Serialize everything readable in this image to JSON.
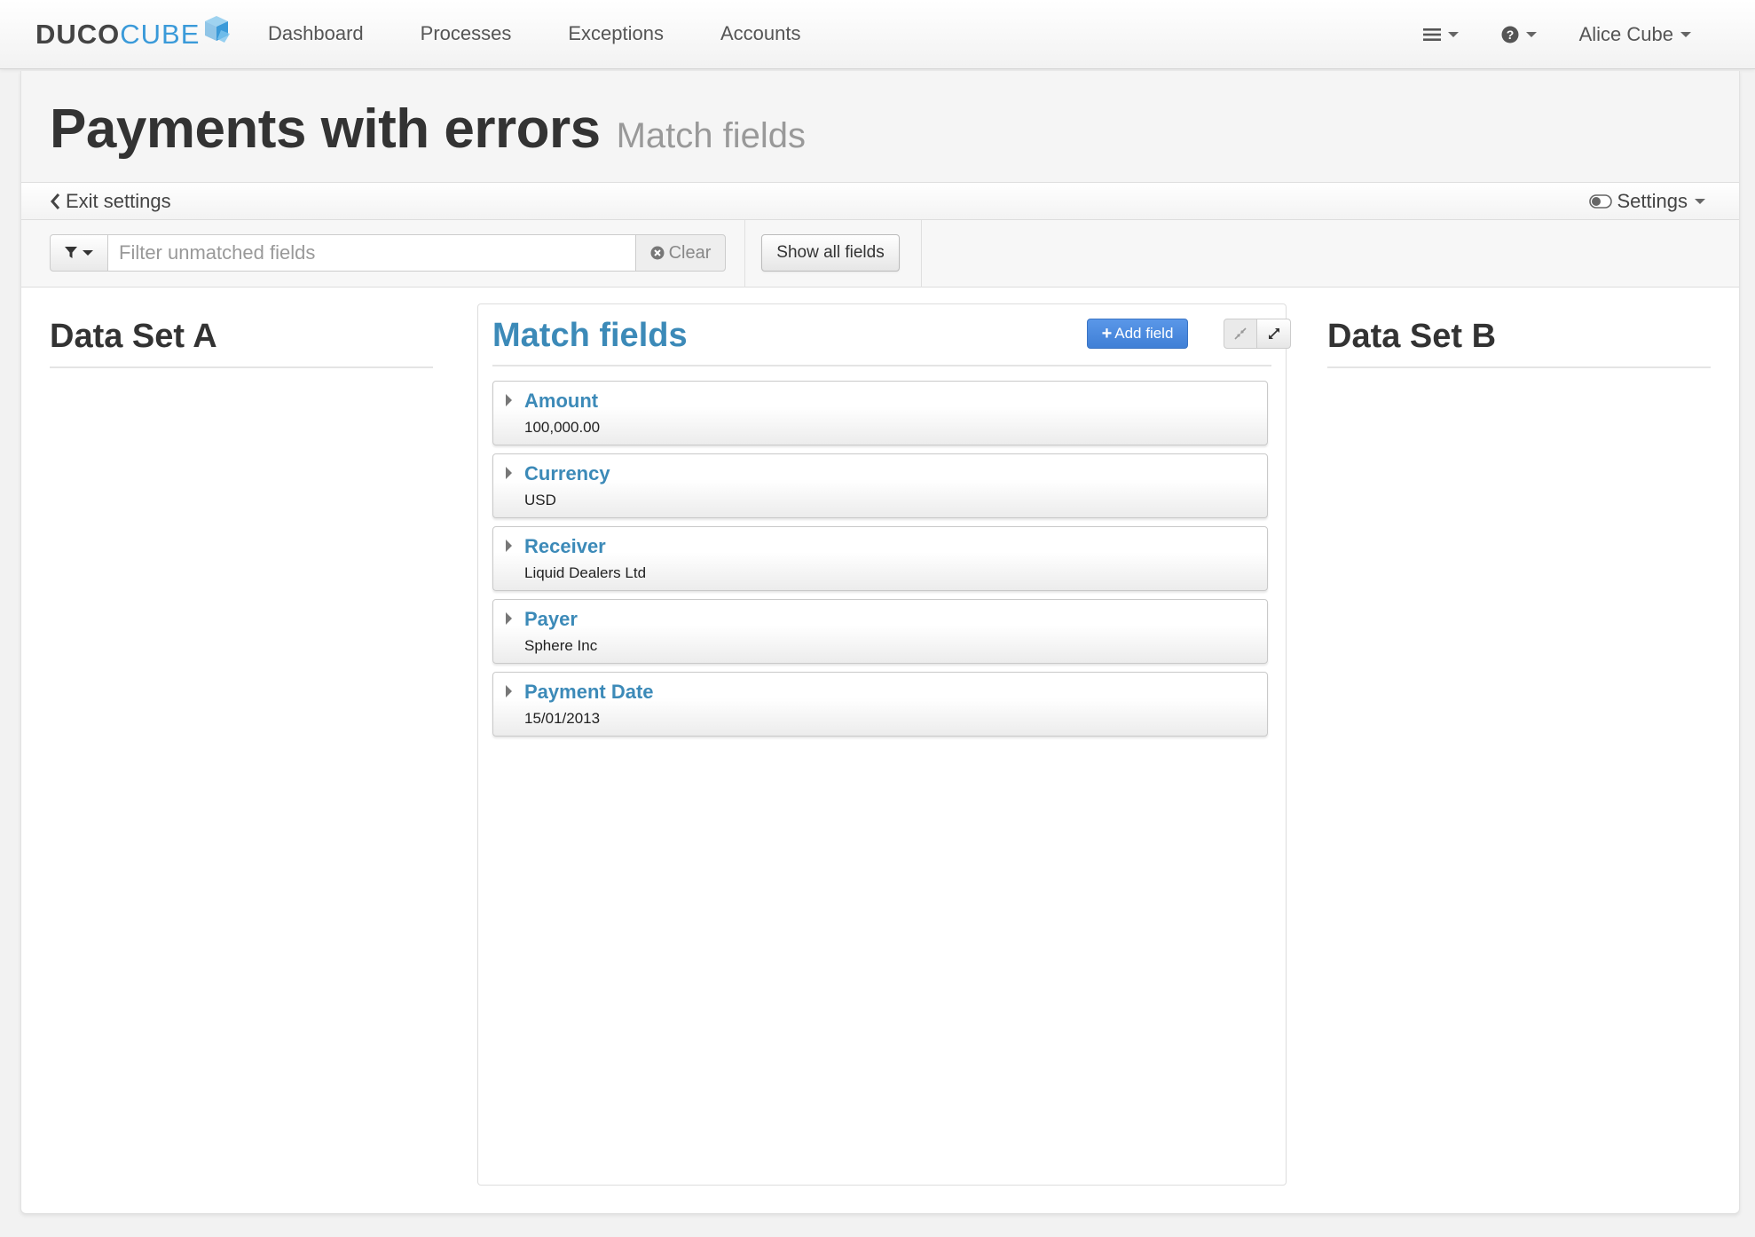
{
  "brand": {
    "part1": "DUCO",
    "part2": "CUBE"
  },
  "nav": {
    "links": [
      "Dashboard",
      "Processes",
      "Exceptions",
      "Accounts"
    ],
    "user": "Alice Cube"
  },
  "page": {
    "title": "Payments with errors",
    "subtitle": "Match fields"
  },
  "settings_bar": {
    "exit_label": "Exit settings",
    "settings_label": "Settings"
  },
  "toolbar": {
    "filter_placeholder": "Filter unmatched fields",
    "clear_label": "Clear",
    "show_all_label": "Show all fields"
  },
  "columns": {
    "left_title": "Data Set A",
    "center_title": "Match fields",
    "right_title": "Data Set B"
  },
  "match_panel": {
    "add_field_label": "Add field",
    "fields": [
      {
        "name": "Amount",
        "value": "100,000.00"
      },
      {
        "name": "Currency",
        "value": "USD"
      },
      {
        "name": "Receiver",
        "value": "Liquid Dealers Ltd"
      },
      {
        "name": "Payer",
        "value": "Sphere Inc"
      },
      {
        "name": "Payment Date",
        "value": "15/01/2013"
      }
    ]
  },
  "colors": {
    "brand_blue": "#3a9ad9",
    "field_title_blue": "#3c8ab8",
    "primary_button": "#4a89dc"
  },
  "icons": [
    "cube-logo-icon",
    "list-menu-icon",
    "help-circle-icon",
    "chevron-left-icon",
    "toggle-icon",
    "filter-icon",
    "clear-circle-icon",
    "plus-icon",
    "compress-icon",
    "expand-icon",
    "caret-right-icon"
  ]
}
